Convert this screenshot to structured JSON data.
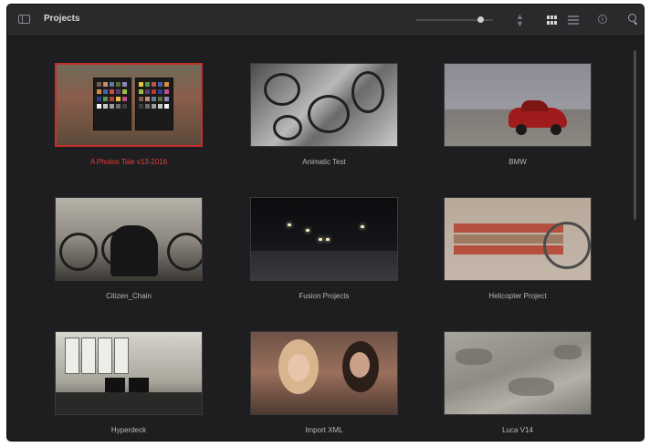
{
  "window": {
    "title": "Projects"
  },
  "toolbar": {
    "icons": [
      "sidebar-toggle-icon",
      "zoom-slider",
      "sort-icon",
      "grid-view-icon",
      "list-view-icon",
      "info-icon",
      "search-icon"
    ],
    "zoom_level": 0.81,
    "active_view": "grid"
  },
  "projects": [
    {
      "name": "A Photos Tale v13-2016",
      "selected": true
    },
    {
      "name": "Animatic Test",
      "selected": false
    },
    {
      "name": "BMW",
      "selected": false
    },
    {
      "name": "Citizen_Chain",
      "selected": false
    },
    {
      "name": "Fusion Projects",
      "selected": false
    },
    {
      "name": "Helicopter Project",
      "selected": false
    },
    {
      "name": "Hyperdeck",
      "selected": false
    },
    {
      "name": "Import XML",
      "selected": false
    },
    {
      "name": "Luca V14",
      "selected": false
    }
  ],
  "colors": {
    "selection": "#c4302b",
    "background": "#1e1e20",
    "toolbar": "#2a2a2c"
  }
}
